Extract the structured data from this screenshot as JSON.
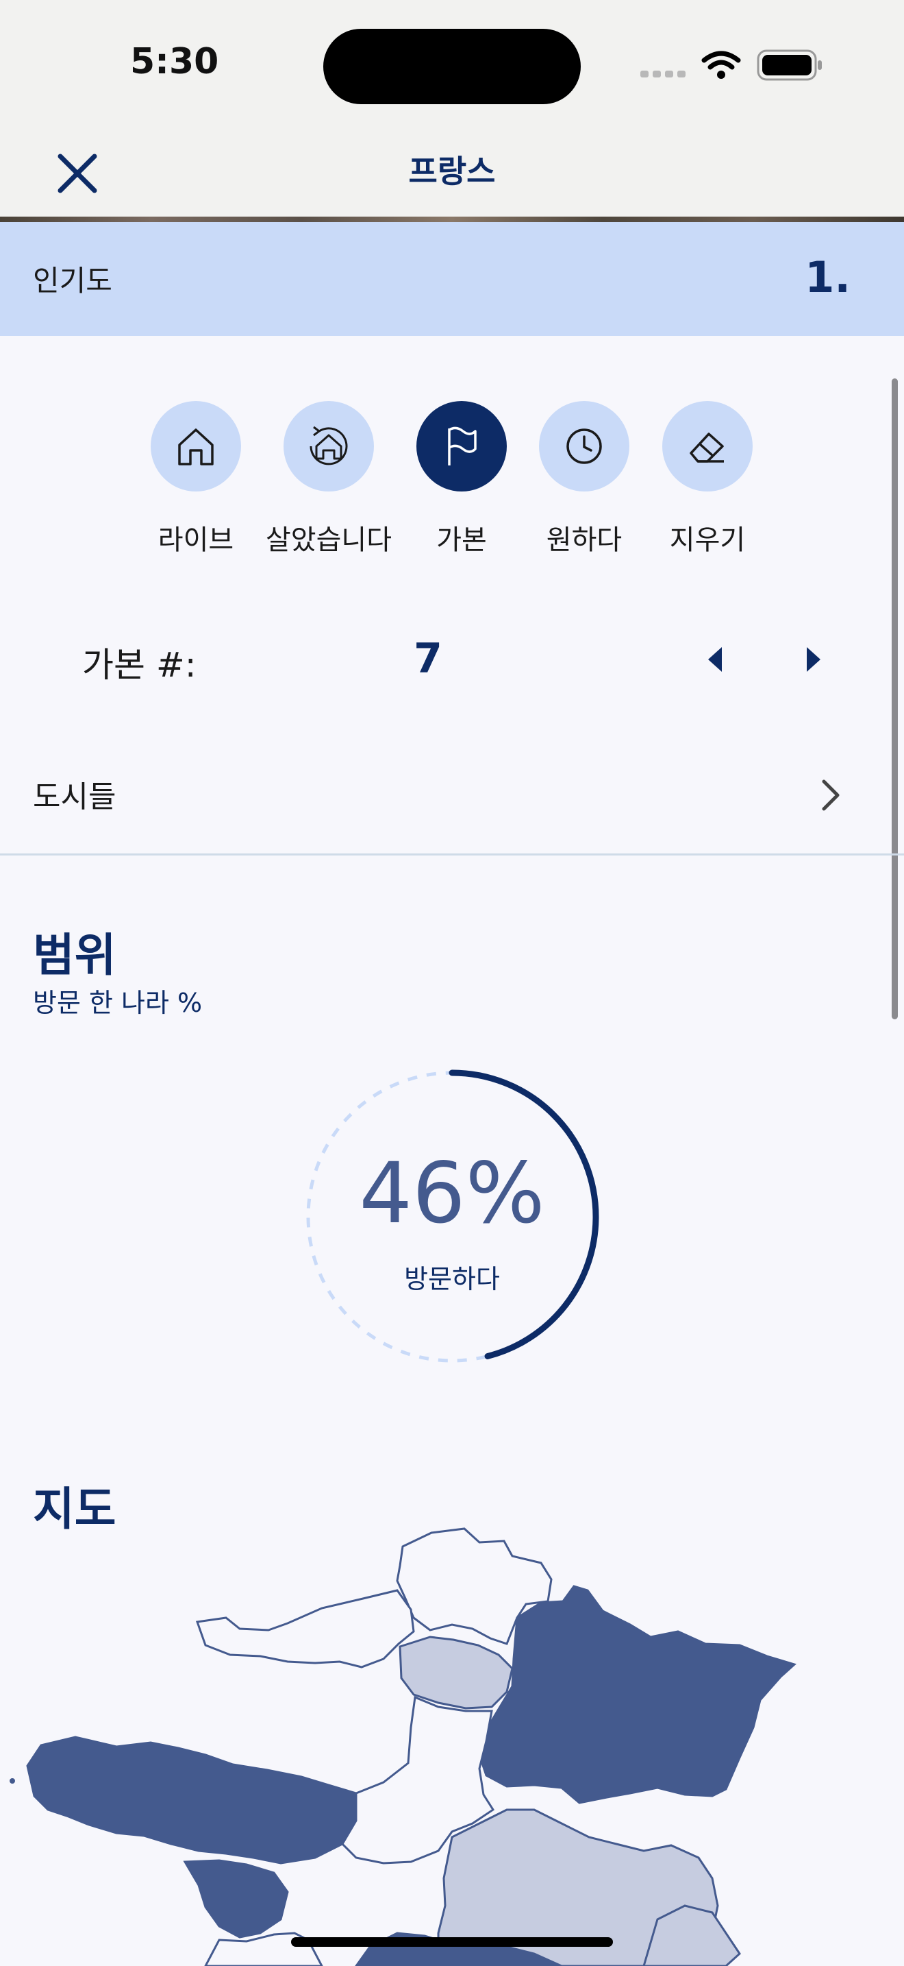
{
  "status_bar": {
    "time": "5:30"
  },
  "nav": {
    "title": "프랑스",
    "close_icon": "close-icon"
  },
  "popularity": {
    "label": "인기도",
    "value": "1."
  },
  "statuses": [
    {
      "label": "라이브",
      "icon": "home-icon",
      "active": false
    },
    {
      "label": "살았습니다",
      "icon": "home-history-icon",
      "active": false
    },
    {
      "label": "가본",
      "icon": "flag-icon",
      "active": true
    },
    {
      "label": "원하다",
      "icon": "clock-icon",
      "active": false
    },
    {
      "label": "지우기",
      "icon": "eraser-icon",
      "active": false
    }
  ],
  "counter": {
    "label": "가본 #:",
    "value": "7"
  },
  "cities": {
    "label": "도시들"
  },
  "range": {
    "title": "범위",
    "subtitle": "방문 한 나라 %",
    "percent": "46%",
    "percent_value": 0.46,
    "caption": "방문하다"
  },
  "map": {
    "title": "지도"
  },
  "colors": {
    "primary": "#0d2b66",
    "accent_light": "#c9daf8",
    "visited": "#445a8e",
    "partial": "#c6cce0"
  }
}
